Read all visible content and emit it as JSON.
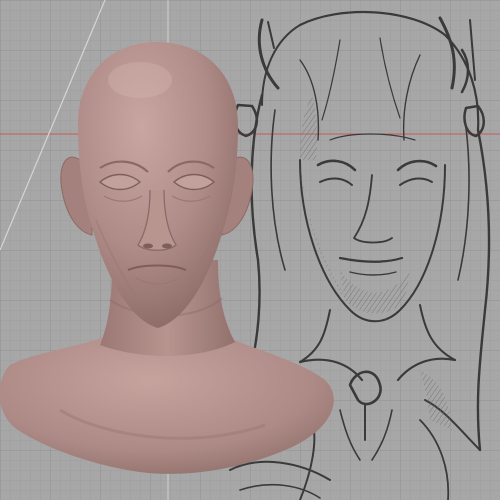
{
  "viewport": {
    "background_color": "#a7a7a7",
    "grid_minor_color": "#9a9a9a",
    "grid_major_color": "#8f8f8f",
    "horizon_line_color": "#c05a5a",
    "vertical_axis_color": "#d5d5d5",
    "diagonal_guide_color": "#cfcfcf"
  },
  "model": {
    "name": "sculpted-bust",
    "skin_color": "#b08c88",
    "skin_highlight": "#c7a39e",
    "skin_shadow": "#8b6a66"
  },
  "reference": {
    "name": "character-sketch-reference",
    "stroke_color": "#3a3a3a",
    "hatch_color": "#6a6a6a"
  }
}
